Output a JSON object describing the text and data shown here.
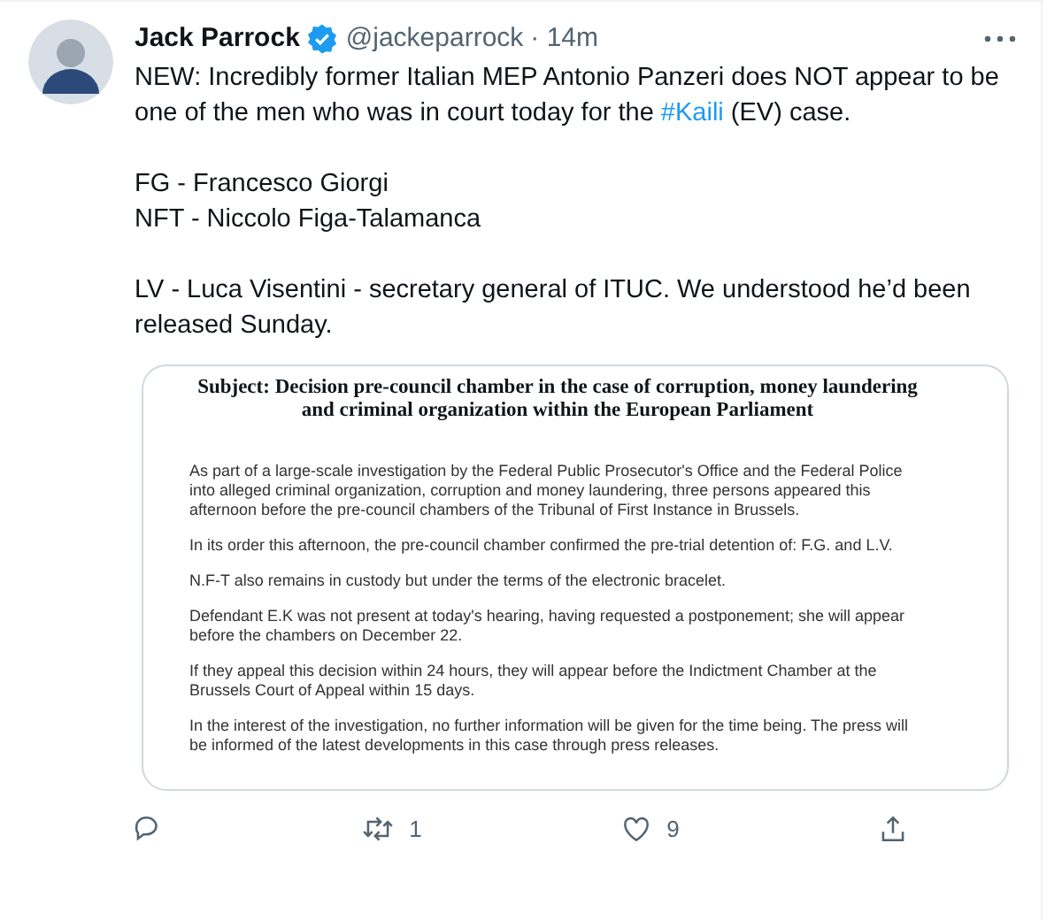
{
  "tweet": {
    "author": "Jack Parrock",
    "verified": true,
    "handle": "@jackeparrock",
    "time": "· 14m",
    "paragraphs": [
      [
        {
          "kind": "text",
          "text": "NEW: Incredibly former Italian MEP Antonio Panzeri does NOT appear to be one of the men who was in court today for the "
        },
        {
          "kind": "hashtag",
          "text": "#Kaili"
        },
        {
          "kind": "text",
          "text": " (EV) case."
        }
      ],
      [
        {
          "kind": "text",
          "text": "FG - Francesco Giorgi"
        }
      ],
      [
        {
          "kind": "text",
          "text": "NFT - Niccolo Figa-Talamanca"
        }
      ],
      [
        {
          "kind": "text",
          "text": "LV - Luca Visentini - secretary general of ITUC. We understood he’d been released Sunday."
        }
      ]
    ],
    "document": {
      "title": "Subject: Decision pre-council chamber in the case of corruption, money laundering and criminal organization within the European Parliament",
      "paragraphs": [
        "As part of a large-scale investigation by the Federal Public Prosecutor's Office and the Federal Police into alleged criminal organization, corruption and money laundering, three persons appeared this afternoon before the pre-council chambers of the Tribunal of First Instance in Brussels.",
        "In its order this afternoon, the pre-council chamber confirmed the pre-trial detention of: F.G. and L.V.",
        "N.F-T also remains in custody but under the terms of the electronic bracelet.",
        "Defendant E.K was not present at today's hearing, having requested a postponement; she will appear before the chambers on December 22.",
        "If they appeal this decision within 24 hours, they will appear before the Indictment Chamber at the Brussels Court of Appeal within 15 days.",
        "In the interest of the investigation, no further information will be given for the time being. The press will be informed of the latest developments in this case through press releases."
      ]
    },
    "actions": [
      {
        "kind": "reply"
      },
      {
        "kind": "retweet",
        "count": "1"
      },
      {
        "kind": "like",
        "count": "9"
      },
      {
        "kind": "share"
      }
    ]
  }
}
